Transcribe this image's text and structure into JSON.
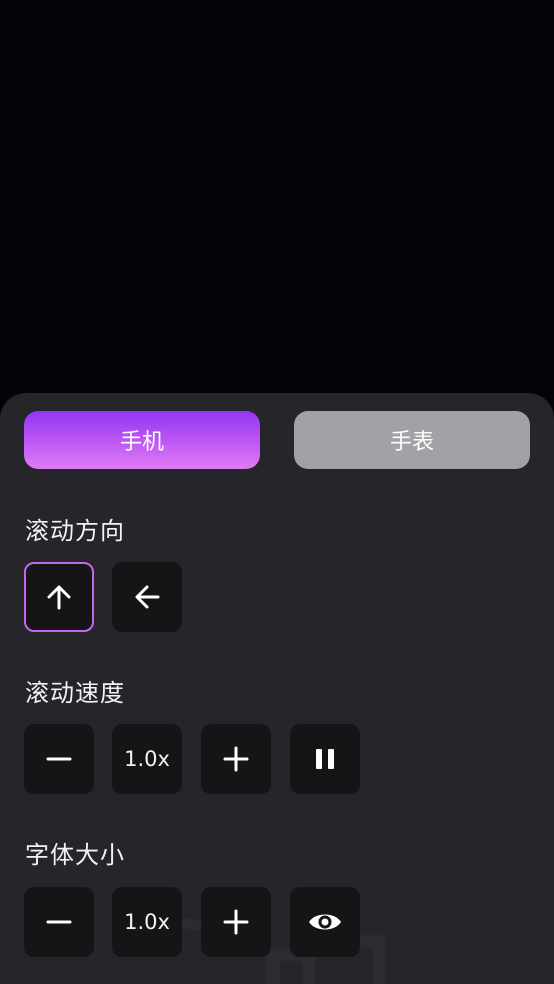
{
  "tabs": {
    "phone": "手机",
    "watch": "手表",
    "active": "phone"
  },
  "scroll_direction": {
    "label": "滚动方向",
    "options": [
      {
        "icon": "arrow-up-icon",
        "selected": true
      },
      {
        "icon": "arrow-left-icon",
        "selected": false
      }
    ]
  },
  "scroll_speed": {
    "label": "滚动速度",
    "value": "1.0x",
    "icons": [
      "minus-icon",
      "plus-icon",
      "pause-icon"
    ]
  },
  "font_size": {
    "label": "字体大小",
    "value": "1.0x",
    "icons": [
      "minus-icon",
      "plus-icon",
      "eye-icon"
    ]
  },
  "colors": {
    "background": "#05030a",
    "panel": "#28282c",
    "button": "#151517",
    "accent_start": "#9434f5",
    "accent_end": "#e07af3",
    "selected_border": "#c565f0",
    "inactive_tab": "#a2a2a6"
  }
}
